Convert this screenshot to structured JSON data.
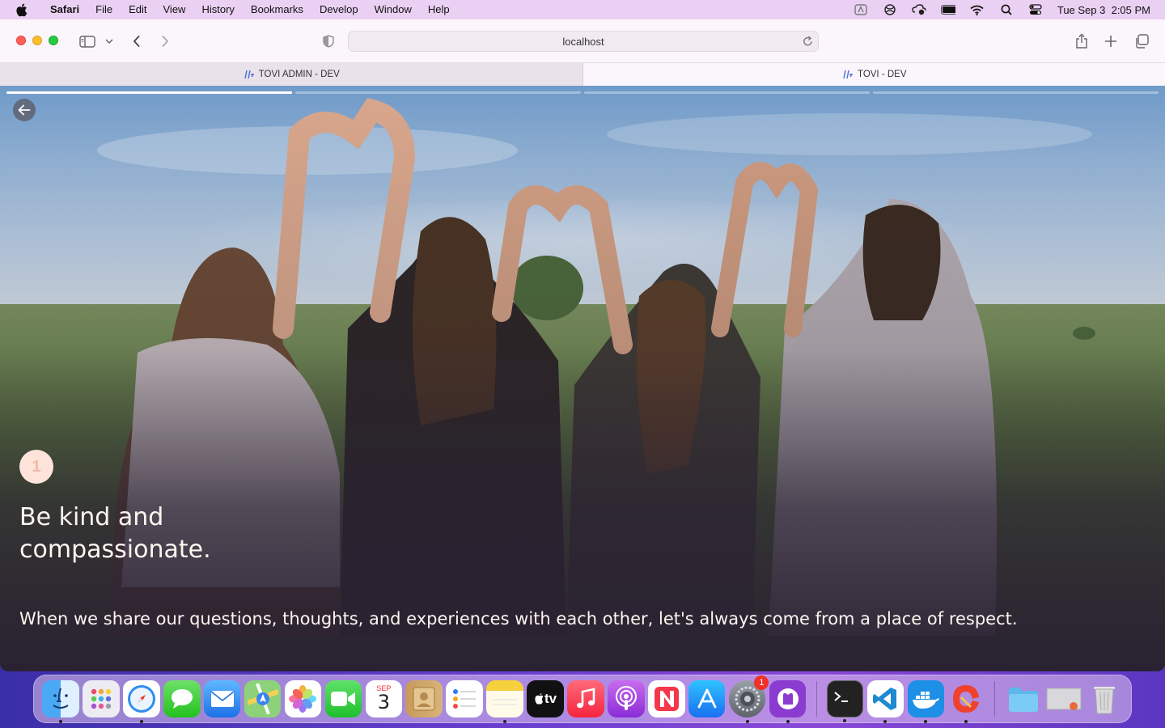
{
  "menubar": {
    "app_name": "Safari",
    "items": [
      "File",
      "Edit",
      "View",
      "History",
      "Bookmarks",
      "Develop",
      "Window",
      "Help"
    ],
    "clock": "Tue Sep 3  2:05 PM"
  },
  "browser": {
    "url": "localhost",
    "tabs": [
      {
        "title": "TOVI ADMIN - DEV",
        "active": false
      },
      {
        "title": "TOVI - DEV",
        "active": true
      }
    ]
  },
  "story": {
    "step_number": "1",
    "headline": "Be kind and compassionate.",
    "body": "When we share our questions, thoughts, and experiences with each other, let's always come from a place of respect.",
    "progress": [
      1,
      0,
      0,
      0
    ]
  },
  "dock": {
    "apps": [
      {
        "icon": "finder-icon",
        "running": true
      },
      {
        "icon": "launchpad-icon",
        "running": false
      },
      {
        "icon": "safari-icon",
        "running": true
      },
      {
        "icon": "messages-icon",
        "running": false
      },
      {
        "icon": "mail-icon",
        "running": false
      },
      {
        "icon": "maps-icon",
        "running": false
      },
      {
        "icon": "photos-icon",
        "running": false
      },
      {
        "icon": "facetime-icon",
        "running": false
      },
      {
        "icon": "calendar-icon",
        "running": false,
        "month": "SEP",
        "day": "3"
      },
      {
        "icon": "contacts-icon",
        "running": false
      },
      {
        "icon": "reminders-icon",
        "running": false
      },
      {
        "icon": "notes-icon",
        "running": true
      },
      {
        "icon": "appletv-icon",
        "running": false,
        "label": "tv"
      },
      {
        "icon": "music-icon",
        "running": false
      },
      {
        "icon": "podcasts-icon",
        "running": false
      },
      {
        "icon": "news-icon",
        "running": false
      },
      {
        "icon": "appstore-icon",
        "running": false
      },
      {
        "icon": "system-settings-icon",
        "running": true,
        "badge": "1"
      },
      {
        "icon": "github-desktop-icon",
        "running": true
      },
      {
        "icon": "terminal-icon",
        "running": true
      },
      {
        "icon": "vscode-icon",
        "running": true
      },
      {
        "icon": "docker-icon",
        "running": true
      },
      {
        "icon": "ccleaner-icon",
        "running": true
      },
      {
        "icon": "downloads-folder-icon",
        "running": false
      },
      {
        "icon": "screenshot-stack-icon",
        "running": false
      },
      {
        "icon": "trash-icon",
        "running": false
      }
    ]
  },
  "colors": {
    "menubar_bg": "#ead0f2",
    "toolbar_bg": "#fbf6fb",
    "badge_bg": "#fde3da",
    "text_light": "#fff5ef"
  }
}
